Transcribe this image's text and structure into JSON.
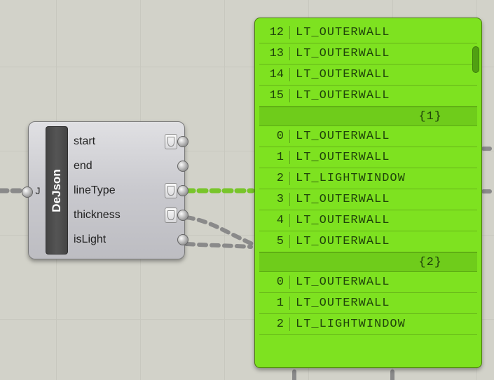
{
  "canvas": {
    "grid_label": "canvas"
  },
  "node": {
    "title": "DeJson",
    "input_label": "J",
    "outputs": [
      {
        "label": "start",
        "has_modifier": true
      },
      {
        "label": "end",
        "has_modifier": false
      },
      {
        "label": "lineType",
        "has_modifier": true
      },
      {
        "label": "thickness",
        "has_modifier": true
      },
      {
        "label": "isLight",
        "has_modifier": false
      }
    ]
  },
  "panel": {
    "groups": [
      {
        "header": null,
        "rows": [
          {
            "index": "12",
            "value": "LT_OUTERWALL"
          },
          {
            "index": "13",
            "value": "LT_OUTERWALL"
          },
          {
            "index": "14",
            "value": "LT_OUTERWALL"
          },
          {
            "index": "15",
            "value": "LT_OUTERWALL"
          }
        ]
      },
      {
        "header": "{1}",
        "rows": [
          {
            "index": "0",
            "value": "LT_OUTERWALL"
          },
          {
            "index": "1",
            "value": "LT_OUTERWALL"
          },
          {
            "index": "2",
            "value": "LT_LIGHTWINDOW"
          },
          {
            "index": "3",
            "value": "LT_OUTERWALL"
          },
          {
            "index": "4",
            "value": "LT_OUTERWALL"
          },
          {
            "index": "5",
            "value": "LT_OUTERWALL"
          }
        ]
      },
      {
        "header": "{2}",
        "rows": [
          {
            "index": "0",
            "value": "LT_OUTERWALL"
          },
          {
            "index": "1",
            "value": "LT_OUTERWALL"
          },
          {
            "index": "2",
            "value": "LT_LIGHTWINDOW"
          }
        ]
      }
    ]
  }
}
